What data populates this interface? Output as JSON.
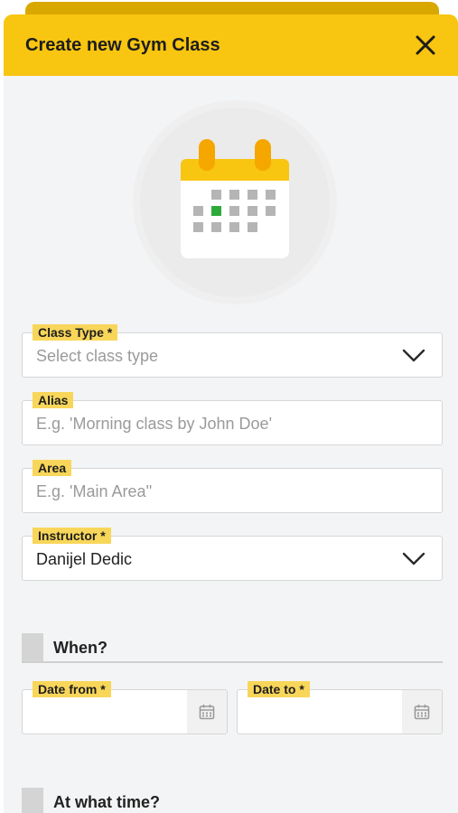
{
  "header": {
    "title": "Create new Gym Class"
  },
  "form": {
    "class_type": {
      "label": "Class Type *",
      "placeholder": "Select class type"
    },
    "alias": {
      "label": "Alias",
      "placeholder": "E.g. 'Morning class by John Doe'"
    },
    "area": {
      "label": "Area",
      "placeholder": "E.g. 'Main Area''"
    },
    "instructor": {
      "label": "Instructor *",
      "value": "Danijel Dedic"
    }
  },
  "sections": {
    "when": {
      "title": "When?"
    },
    "time": {
      "title": "At what time?"
    }
  },
  "dates": {
    "from": {
      "label": "Date from *"
    },
    "to": {
      "label": "Date to *"
    }
  },
  "icons": {
    "close": "close-icon",
    "chevron": "chevron-down-icon",
    "calendar": "calendar-icon",
    "illustration": "calendar-illustration-icon"
  },
  "colors": {
    "accent": "#f8c511",
    "label_bg": "#f8d65a",
    "highlight_day": "#2eaa3a"
  }
}
